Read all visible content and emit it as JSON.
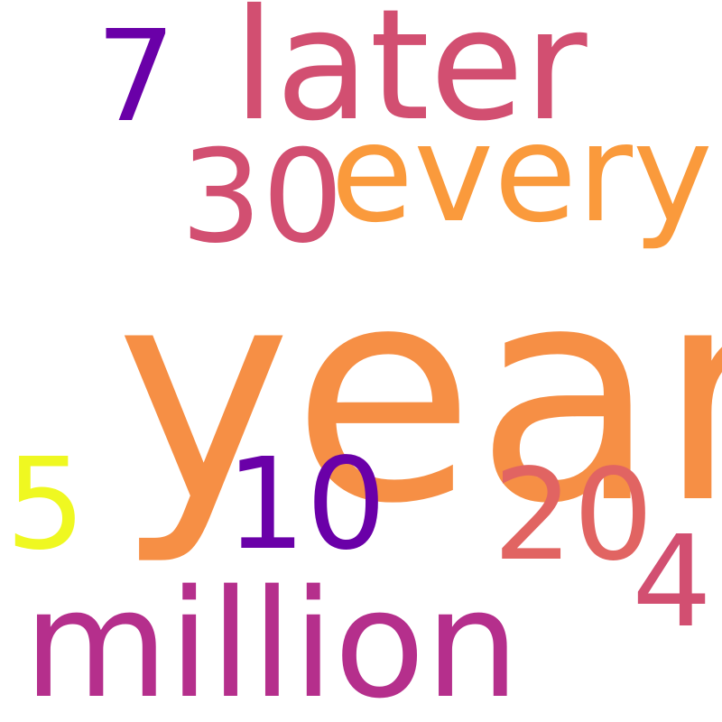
{
  "words": {
    "year": {
      "text": "year",
      "color": "#f68f45"
    },
    "later": {
      "text": "later",
      "color": "#d24f71"
    },
    "seven": {
      "text": "7",
      "color": "#6a00a8"
    },
    "every": {
      "text": "every",
      "color": "#fa9a3c"
    },
    "thirty": {
      "text": "30",
      "color": "#d24f71"
    },
    "five": {
      "text": "5",
      "color": "#eff821"
    },
    "ten": {
      "text": "10",
      "color": "#6a00a8"
    },
    "twenty": {
      "text": "20",
      "color": "#e16462"
    },
    "four": {
      "text": "4",
      "color": "#d24f71"
    },
    "million": {
      "text": "million",
      "color": "#b52f8c"
    }
  }
}
